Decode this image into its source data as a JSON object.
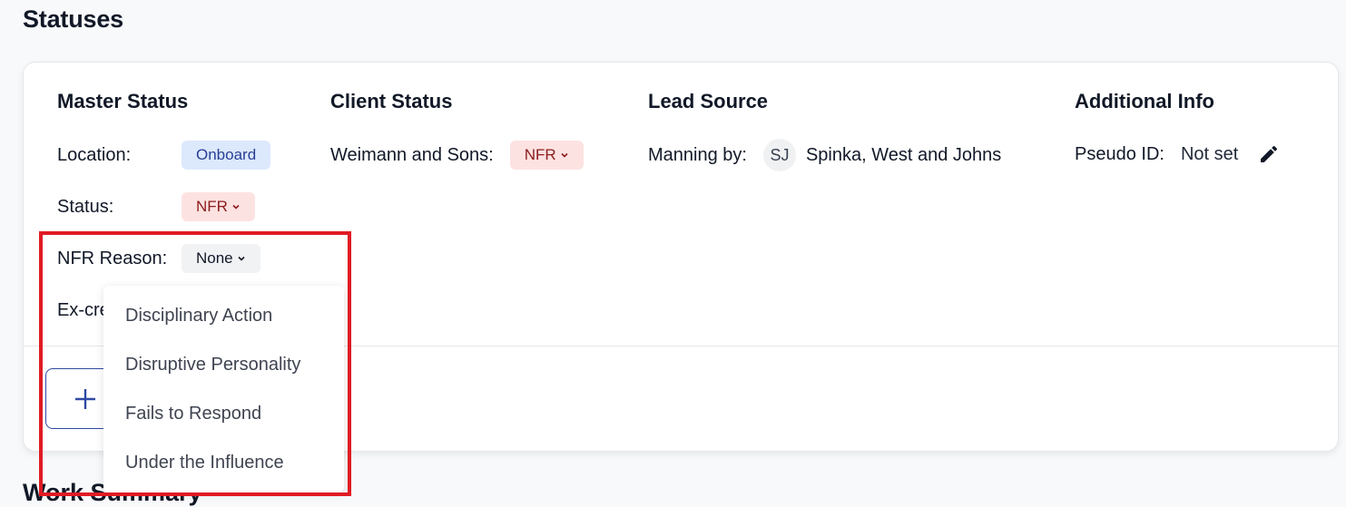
{
  "section_title": "Statuses",
  "next_section_title": "Work Summary",
  "master_status": {
    "heading": "Master Status",
    "location_label": "Location:",
    "location_value": "Onboard",
    "status_label": "Status:",
    "status_value": "NFR",
    "nfr_reason_label": "NFR Reason:",
    "nfr_reason_value": "None",
    "ex_crew_label": "Ex-crew"
  },
  "client_status": {
    "heading": "Client Status",
    "client_label": "Weimann and Sons:",
    "client_value": "NFR"
  },
  "lead_source": {
    "heading": "Lead Source",
    "manning_label": "Manning by:",
    "avatar_initials": "SJ",
    "manning_value": "Spinka, West and Johns"
  },
  "additional_info": {
    "heading": "Additional Info",
    "pseudo_id_label": "Pseudo ID:",
    "pseudo_id_value": "Not set"
  },
  "nfr_reason_dropdown": {
    "options": [
      "Disciplinary Action",
      "Disruptive Personality",
      "Fails to Respond",
      "Under the Influence"
    ]
  },
  "colors": {
    "highlight": "#e01b24",
    "accent_blue": "#2f4aa3",
    "badge_red_bg": "#fde2e2",
    "badge_red_text": "#8b1c1c",
    "badge_blue_bg": "#dce8fc",
    "badge_blue_text": "#283f96"
  }
}
